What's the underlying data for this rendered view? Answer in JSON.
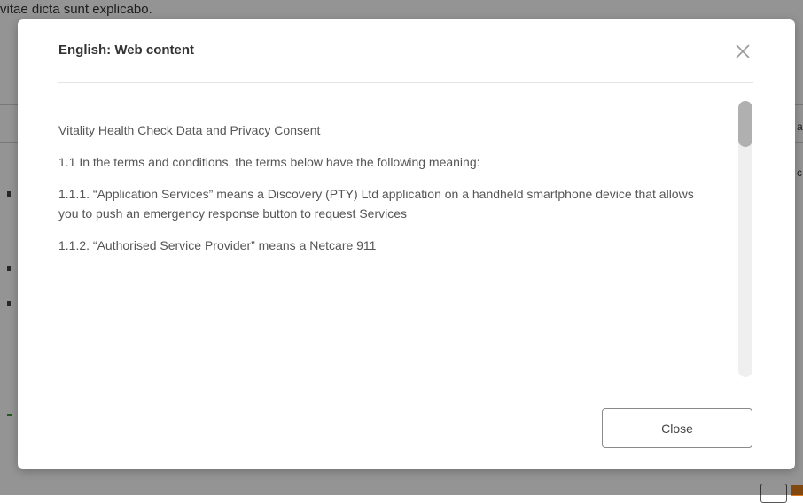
{
  "background": {
    "top_text": "vitae dicta sunt explicabo.",
    "right_chars": [
      "a",
      "c"
    ]
  },
  "modal": {
    "title": "English: Web content",
    "close_icon": "close-icon",
    "body": {
      "paragraphs": [
        "Vitality Health Check Data and Privacy Consent",
        "1.1 In the terms and conditions, the terms below have the following meaning:",
        "1.1.1. “Application Services” means a Discovery (PTY) Ltd application on a handheld smartphone device that allows you to push an emergency response button to request Services",
        "1.1.2. “Authorised Service Provider” means a Netcare 911"
      ]
    },
    "close_button_label": "Close"
  },
  "colors": {
    "overlay": "#000000",
    "modal_bg": "#ffffff",
    "scroll_thumb": "#b0b0b0"
  }
}
